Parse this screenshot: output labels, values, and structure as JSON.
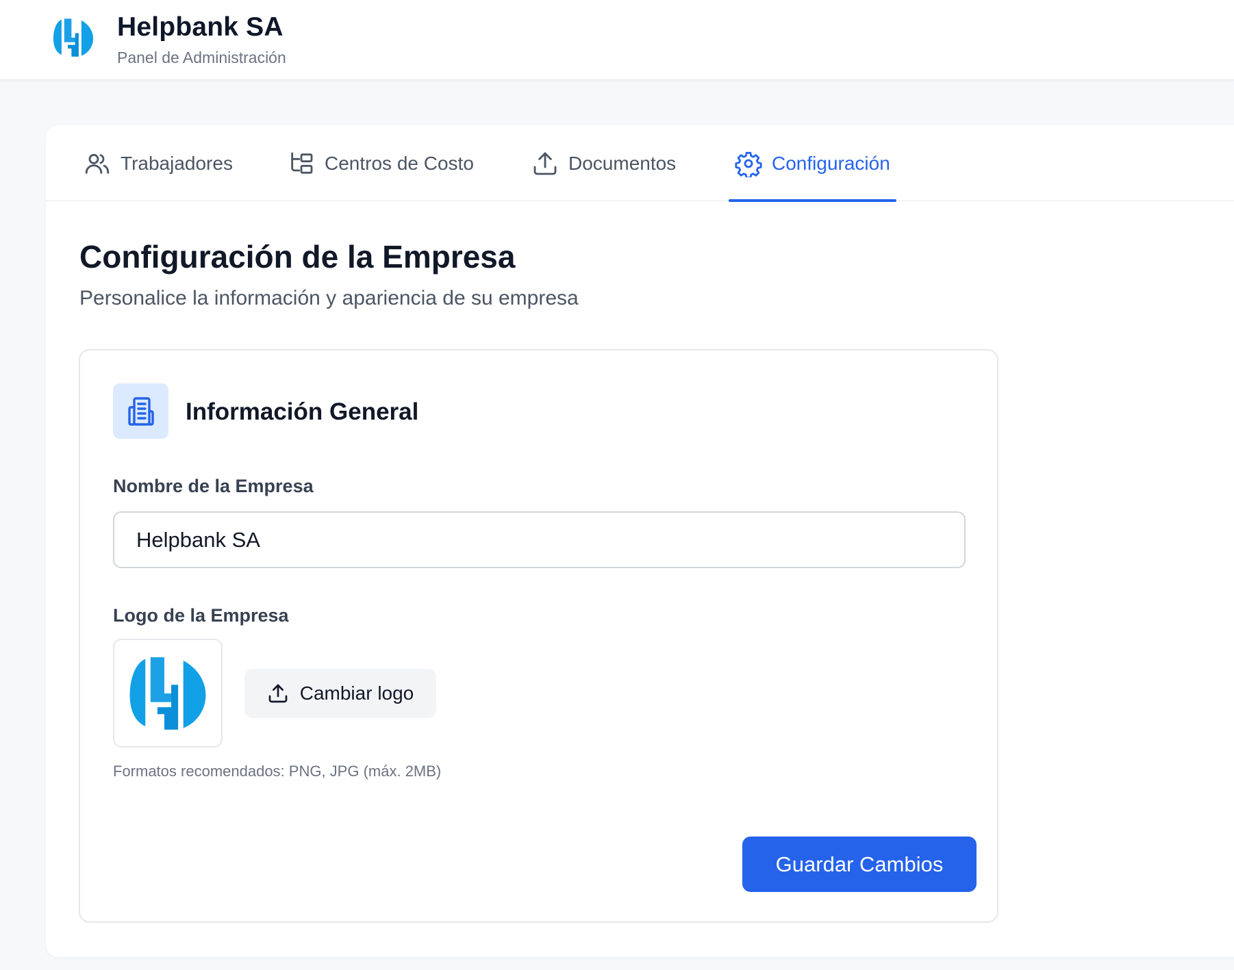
{
  "header": {
    "company_name": "Helpbank SA",
    "subtitle": "Panel de Administración",
    "logo_icon": "helpbank-logo"
  },
  "tabs": [
    {
      "label": "Trabajadores",
      "icon": "users-icon",
      "active": false
    },
    {
      "label": "Centros de Costo",
      "icon": "folder-tree-icon",
      "active": false
    },
    {
      "label": "Documentos",
      "icon": "upload-icon",
      "active": false
    },
    {
      "label": "Configuración",
      "icon": "gear-icon",
      "active": true
    }
  ],
  "page": {
    "title": "Configuración de la Empresa",
    "subtitle": "Personalice la información y apariencia de su empresa"
  },
  "card": {
    "title": "Información General",
    "icon": "building-icon",
    "company_name_label": "Nombre de la Empresa",
    "company_name_value": "Helpbank SA",
    "logo_label": "Logo de la Empresa",
    "change_logo_label": "Cambiar logo",
    "hint": "Formatos recomendados: PNG, JPG (máx. 2MB)",
    "save_label": "Guardar Cambios"
  },
  "colors": {
    "accent": "#2563eb",
    "accent_light": "#dbeafe",
    "logo_blue": "#1da1e6"
  }
}
